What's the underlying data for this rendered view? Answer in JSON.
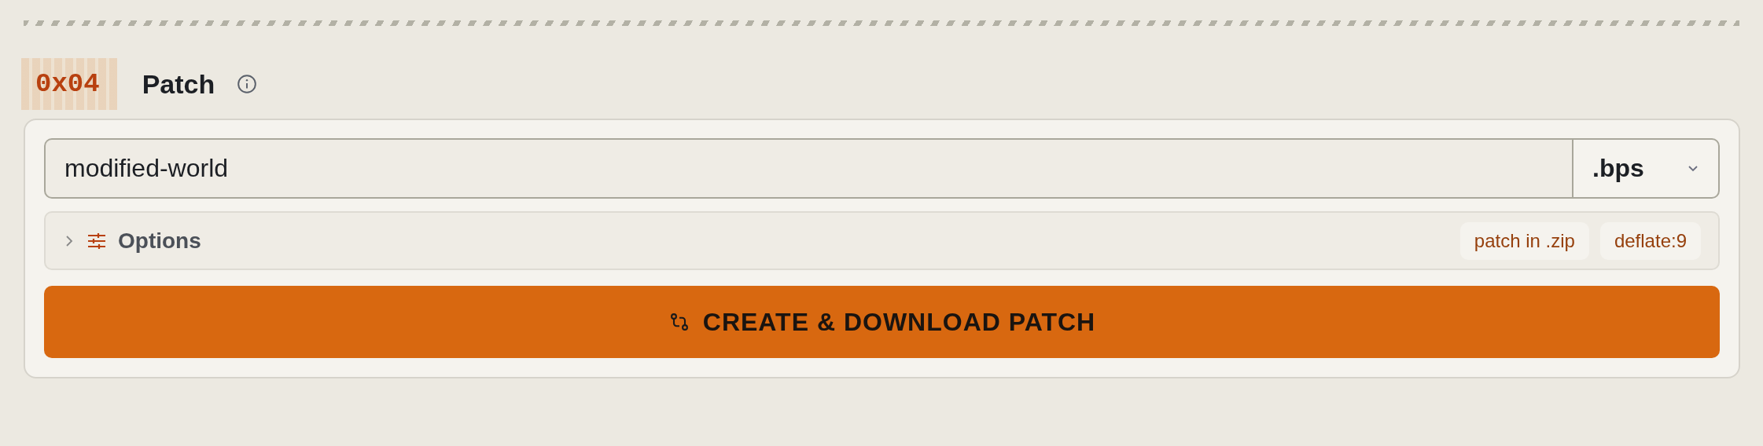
{
  "section": {
    "number": "0x04",
    "title": "Patch"
  },
  "filename": {
    "value": "modified-world"
  },
  "format": {
    "value": ".bps"
  },
  "options": {
    "label": "Options",
    "expanded": false,
    "tags": [
      "patch in .zip",
      "deflate:9"
    ]
  },
  "action": {
    "label": "CREATE & DOWNLOAD PATCH"
  }
}
